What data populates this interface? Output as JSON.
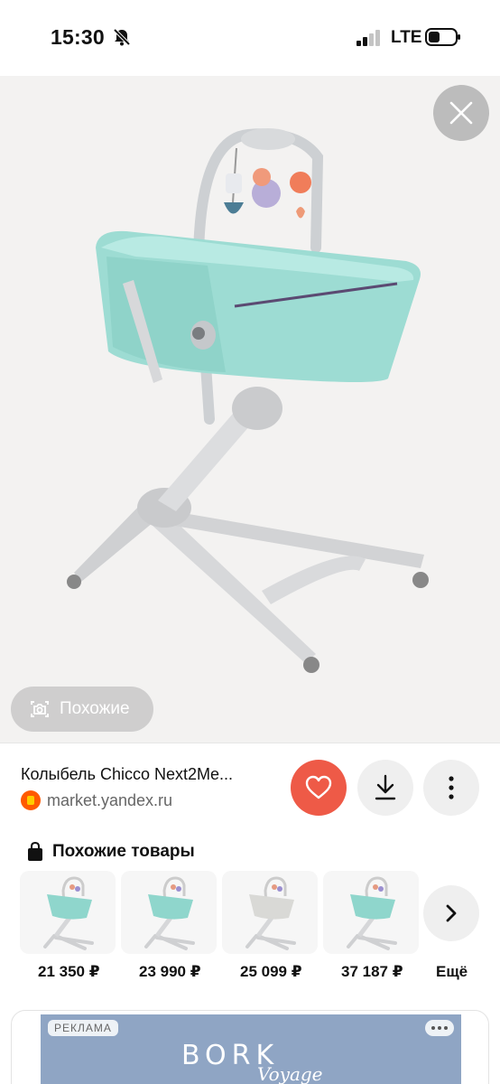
{
  "status": {
    "time": "15:30",
    "network": "LTE"
  },
  "hero": {
    "similar_label": "Похожие"
  },
  "info": {
    "title": "Колыбель Chicco Next2Me...",
    "source": "market.yandex.ru"
  },
  "similar": {
    "title": "Похожие товары",
    "items": [
      {
        "price": "21 350 ₽",
        "color": "#8fd6cc"
      },
      {
        "price": "23 990 ₽",
        "color": "#8fd6cc"
      },
      {
        "price": "25 099 ₽",
        "color": "#d9d9d6"
      },
      {
        "price": "37 187 ₽",
        "color": "#8fd6cc"
      }
    ],
    "more_label": "Ещё"
  },
  "ad": {
    "tag": "РЕКЛАМА",
    "brand": "BORK",
    "tagline": "Voyage"
  }
}
